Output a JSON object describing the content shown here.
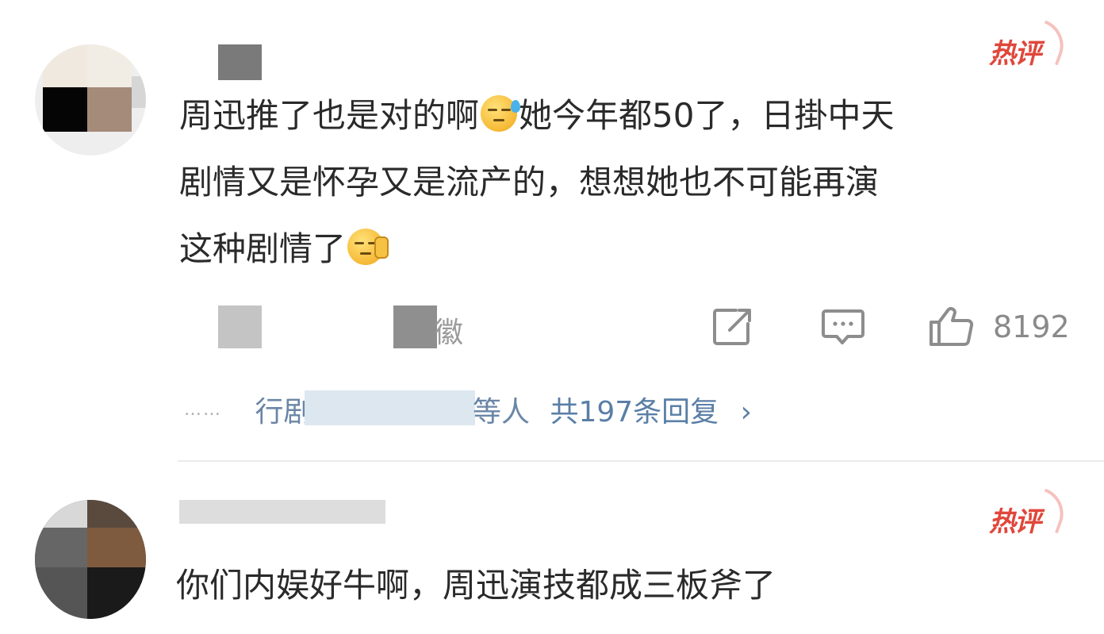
{
  "comments": [
    {
      "text_line1_a": "周迅推了也是对的啊",
      "text_line1_b": "她今年都50了，日掛中天",
      "text_line2": "剧情又是怀孕又是流产的，想想她也不可能再演",
      "text_line3": "这种剧情了",
      "emoji1": "sweat-smile-emoji",
      "emoji2": "salute-emoji",
      "badge": "热评",
      "source_fragment": "徽",
      "like_count": "8192",
      "reply_names_fragment": "行剧",
      "reply_names_suffix": "等人",
      "reply_link": "共197条回复",
      "reply_chevron": "›",
      "reply_dots": "……"
    },
    {
      "text_line1": "你们内娱好牛啊，周迅演技都成三板斧了",
      "badge": "热评"
    }
  ],
  "icons": {
    "repost": "repost-icon",
    "comment": "comment-icon",
    "like": "thumbs-up-icon"
  },
  "colors": {
    "badge": "#e0473b",
    "text": "#2a2a2a",
    "meta": "#9a9a9a",
    "link": "#5a7fa6",
    "divider": "#ececec"
  }
}
